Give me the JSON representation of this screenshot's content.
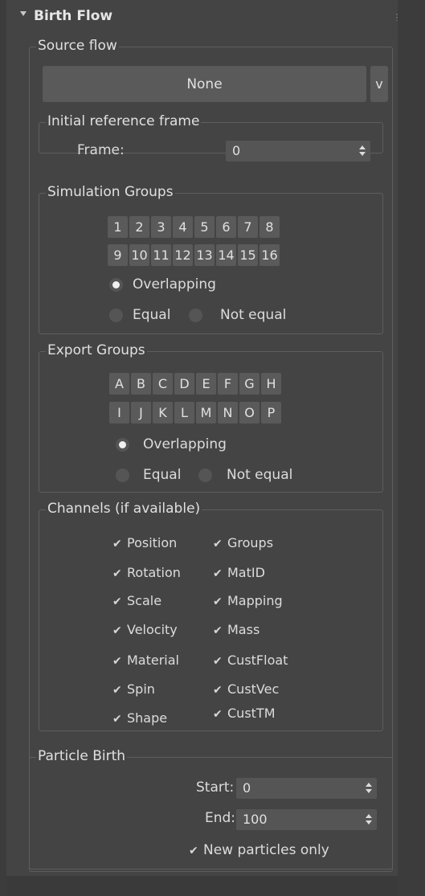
{
  "rollout": {
    "title": "Birth Flow"
  },
  "source_flow": {
    "label": "Source flow",
    "button": "None",
    "dropdown": "v"
  },
  "initial_ref": {
    "label": "Initial reference frame",
    "frame_label": "Frame:",
    "frame_value": "0"
  },
  "sim_groups": {
    "label": "Simulation Groups",
    "buttons": [
      "1",
      "2",
      "3",
      "4",
      "5",
      "6",
      "7",
      "8",
      "9",
      "10",
      "11",
      "12",
      "13",
      "14",
      "15",
      "16"
    ],
    "radio_overlap": "Overlapping",
    "radio_equal": "Equal",
    "radio_not_equal": "Not equal",
    "selected": "Overlapping"
  },
  "export_groups": {
    "label": "Export Groups",
    "buttons": [
      "A",
      "B",
      "C",
      "D",
      "E",
      "F",
      "G",
      "H",
      "I",
      "J",
      "K",
      "L",
      "M",
      "N",
      "O",
      "P"
    ],
    "radio_overlap": "Overlapping",
    "radio_equal": "Equal",
    "radio_not_equal": "Not equal",
    "selected": "Overlapping"
  },
  "channels": {
    "label": "Channels (if available)",
    "left": [
      "Position",
      "Rotation",
      "Scale",
      "Velocity",
      "Material",
      "Spin",
      "Shape"
    ],
    "right": [
      "Groups",
      "MatID",
      "Mapping",
      "Mass",
      "CustFloat",
      "CustVec",
      "CustTM"
    ],
    "checked": true
  },
  "particle_birth": {
    "label": "Particle Birth",
    "start_label": "Start:",
    "start_value": "0",
    "end_label": "End:",
    "end_value": "100",
    "new_only": "New particles only",
    "new_only_checked": true
  },
  "check_mark": "✔"
}
